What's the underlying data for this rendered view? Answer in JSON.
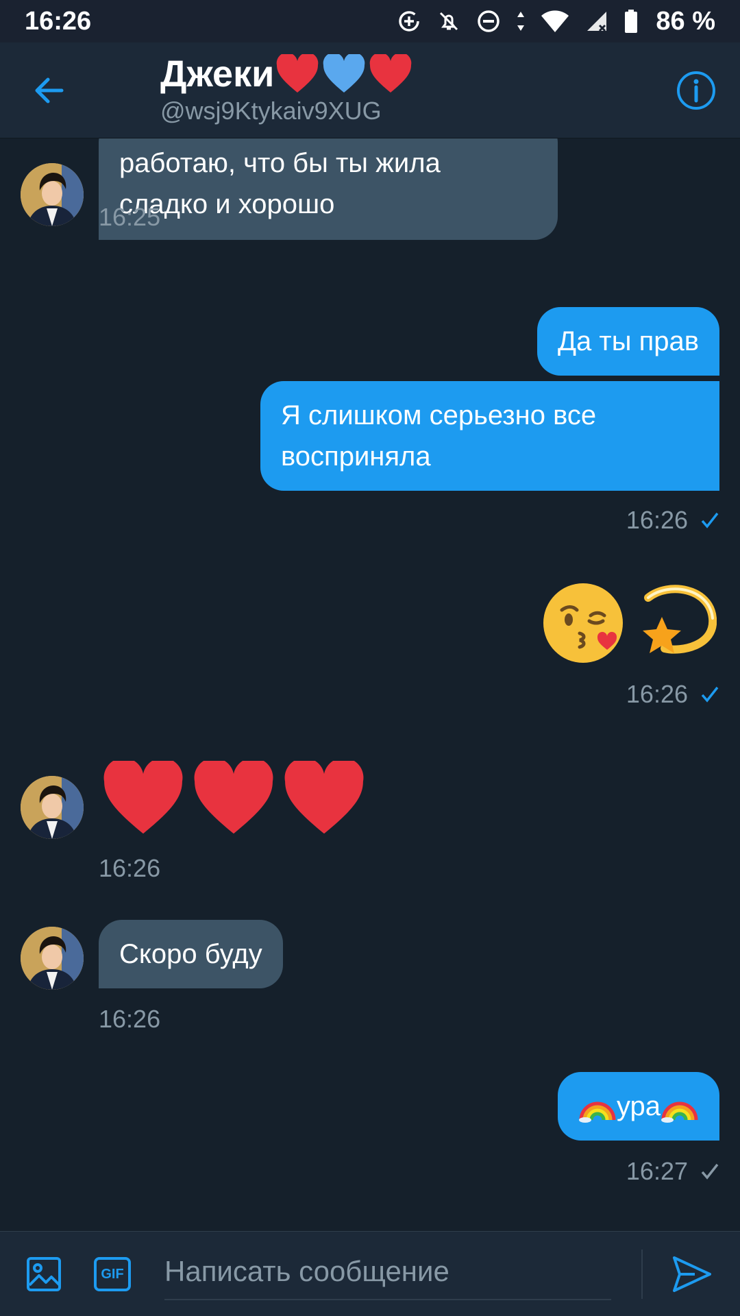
{
  "status_bar": {
    "time": "16:26",
    "battery_percent": "86 %"
  },
  "header": {
    "name": "Джеки",
    "handle": "@wsj9Ktykaiv9XUG",
    "name_emojis": [
      "red-heart",
      "blue-heart",
      "red-heart"
    ]
  },
  "messages": [
    {
      "side": "in",
      "text_line1": "работаю, что бы ты жила",
      "text_line2": "сладко и хорошо",
      "time": "16:25"
    },
    {
      "side": "out",
      "text": "Да ты прав"
    },
    {
      "side": "out",
      "text_line1": "Я слишком серьезно все",
      "text_line2": "восприняла",
      "time": "16:26",
      "status": "sent"
    },
    {
      "side": "out",
      "emoji": [
        "kissing-face-wink",
        "dizzy-star"
      ],
      "time": "16:26",
      "status": "sent"
    },
    {
      "side": "in",
      "emoji": [
        "red-heart",
        "red-heart",
        "red-heart"
      ],
      "time": "16:26"
    },
    {
      "side": "in",
      "text": "Скоро буду",
      "time": "16:26"
    },
    {
      "side": "out",
      "text": "ура",
      "emoji_around": "rainbow",
      "time": "16:27",
      "status": "delivered"
    }
  ],
  "composer": {
    "placeholder": "Написать сообщение",
    "gif_label": "GIF"
  },
  "colors": {
    "background": "#15202b",
    "header": "#1c2938",
    "incoming_bubble": "#3d5466",
    "outgoing_bubble": "#1d9bf0",
    "accent": "#1d9bf0",
    "muted_text": "#8899a6"
  }
}
